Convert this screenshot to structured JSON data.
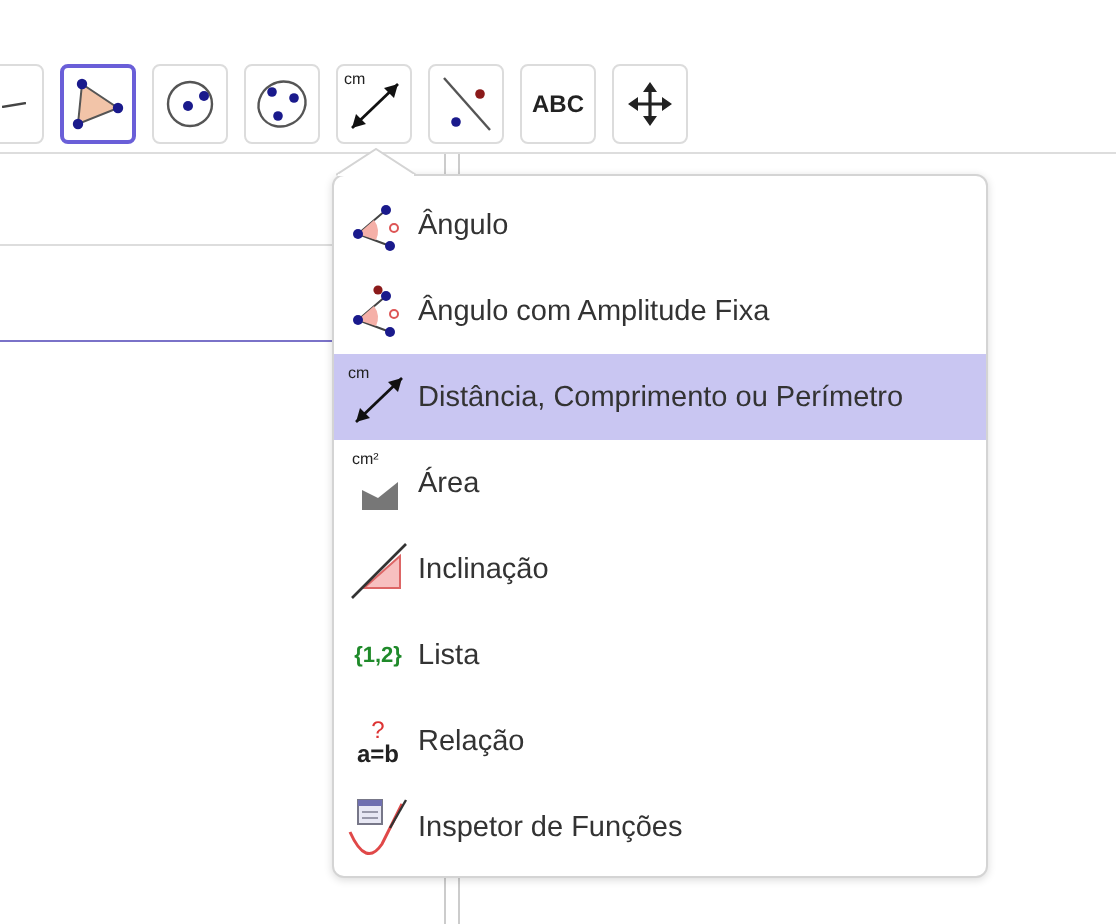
{
  "toolbar": [
    {
      "kind": "line",
      "selected": false
    },
    {
      "kind": "polygon",
      "selected": true
    },
    {
      "kind": "circle",
      "selected": false
    },
    {
      "kind": "conic",
      "selected": false
    },
    {
      "kind": "measure",
      "selected": false,
      "icon_text": "cm"
    },
    {
      "kind": "reflect",
      "selected": false
    },
    {
      "kind": "text",
      "selected": false,
      "icon_text": "ABC"
    },
    {
      "kind": "move",
      "selected": false
    }
  ],
  "menu": {
    "items": [
      {
        "kind": "angle",
        "label": "Ângulo",
        "selected": false
      },
      {
        "kind": "fixed-angle",
        "label": "Ângulo com Amplitude Fixa",
        "selected": false
      },
      {
        "kind": "distance",
        "label": "Distância, Comprimento ou Perímetro",
        "selected": true,
        "icon_text": "cm"
      },
      {
        "kind": "area",
        "label": "Área",
        "selected": false,
        "icon_text": "cm²"
      },
      {
        "kind": "slope",
        "label": "Inclinação",
        "selected": false
      },
      {
        "kind": "list",
        "label": "Lista",
        "selected": false,
        "icon_text": "{1,2}"
      },
      {
        "kind": "relation",
        "label": "Relação",
        "selected": false,
        "icon_text": "a=b",
        "icon_mark": "?"
      },
      {
        "kind": "inspector",
        "label": "Inspetor de Funções",
        "selected": false
      }
    ]
  }
}
